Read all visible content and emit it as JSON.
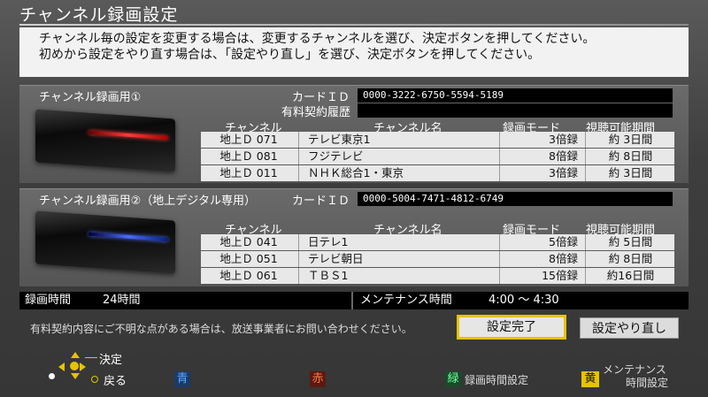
{
  "title": "チャンネル録画設定",
  "message": {
    "line1": "チャンネル毎の設定を変更する場合は、変更するチャンネルを選び、決定ボタンを押してください。",
    "line2": "初めから設定をやり直す場合は、「設定やり直し」を選び、決定ボタンを押してください。"
  },
  "panel1": {
    "title": "チャンネル録画用①",
    "card_label": "カードＩＤ",
    "card_id": "0000-3222-6750-5594-5189",
    "contract_label": "有料契約履歴",
    "headers": {
      "channel": "チャンネル",
      "name": "チャンネル名",
      "mode": "録画モード",
      "period": "視聴可能期間"
    },
    "rows": [
      {
        "channel": "地上Ｄ 071",
        "name": "テレビ東京1",
        "mode": "3倍録",
        "period": "約 3日間"
      },
      {
        "channel": "地上Ｄ 081",
        "name": "フジテレビ",
        "mode": "8倍録",
        "period": "約 8日間"
      },
      {
        "channel": "地上Ｄ 011",
        "name": "ＮＨＫ総合1・東京",
        "mode": "3倍録",
        "period": "約 3日間"
      }
    ]
  },
  "panel2": {
    "title": "チャンネル録画用②（地上デジタル専用）",
    "card_label": "カードＩＤ",
    "card_id": "0000-5004-7471-4812-6749",
    "headers": {
      "channel": "チャンネル",
      "name": "チャンネル名",
      "mode": "録画モード",
      "period": "視聴可能期間"
    },
    "rows": [
      {
        "channel": "地上Ｄ 041",
        "name": "日テレ1",
        "mode": "5倍録",
        "period": "約 5日間"
      },
      {
        "channel": "地上Ｄ 051",
        "name": "テレビ朝日",
        "mode": "8倍録",
        "period": "約 8日間"
      },
      {
        "channel": "地上Ｄ 061",
        "name": "ＴＢＳ1",
        "mode": "15倍録",
        "period": "約16日間"
      }
    ]
  },
  "status": {
    "rec_label": "録画時間",
    "rec_value": "24時間",
    "maint_label": "メンテナンス時間",
    "maint_value": "4:00 〜 4:30"
  },
  "note": "有料契約内容にご不明な点がある場合は、放送事業者にお問い合わせください。",
  "buttons": {
    "done": "設定完了",
    "reset": "設定やり直し"
  },
  "footer": {
    "decide": "決定",
    "back": "戻る",
    "blue_key": "青",
    "red_key": "赤",
    "green_key": "緑",
    "green_label": "録画時間設定",
    "yellow_key": "黄",
    "yellow_label1": "メンテナンス",
    "yellow_label2": "時間設定"
  },
  "colors": {
    "accent_yellow": "#e6c300",
    "blue_key": "#5aa8ff",
    "red_key": "#ff7a4a",
    "green_key": "#6aff9a"
  }
}
